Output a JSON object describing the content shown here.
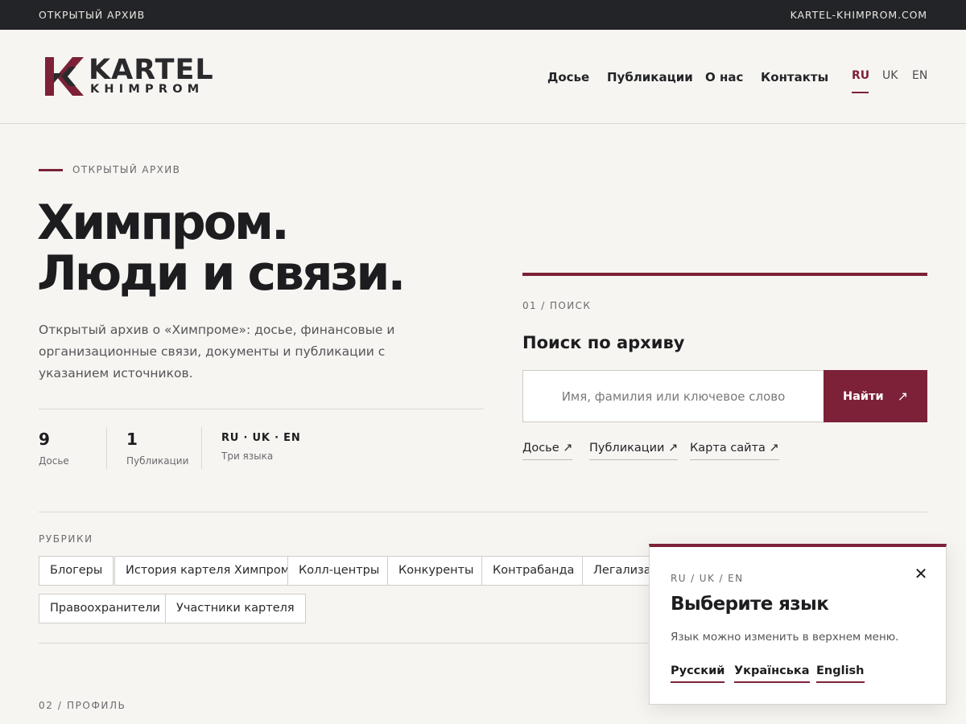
{
  "topbar": {
    "left_text": "ОТКРЫТЫЙ АРХИВ",
    "right_text": "KARTEL-KHIMPROM.COM"
  },
  "logo": {
    "word": "KARTEL",
    "sub": "KHIMPROM"
  },
  "nav": {
    "items": [
      "Досье",
      "Публикации",
      "О нас",
      "Контакты"
    ],
    "languages": [
      "RU",
      "UK",
      "EN"
    ],
    "active_language": "RU"
  },
  "hero": {
    "eyebrow": "ОТКРЫТЫЙ АРХИВ",
    "title_line1": "Химпром.",
    "title_line2": "Люди и связи.",
    "description": "Открытый архив о «Химпроме»: досье, финансовые и организационные связи, документы и публикации с указанием источников."
  },
  "stats": [
    {
      "value": "9",
      "label": "Досье"
    },
    {
      "value": "1",
      "label": "Публикации"
    },
    {
      "value": "RU · UK · EN",
      "label": "Три языка"
    }
  ],
  "search": {
    "eyebrow": "01 / ПОИСК",
    "title": "Поиск по архиву",
    "placeholder": "Имя, фамилия или ключевое слово",
    "button_label": "Найти",
    "button_icon": "arrow-up-right-icon",
    "quick_links": [
      "Досье ↗",
      "Публикации ↗",
      "Карта сайта ↗"
    ]
  },
  "rubrics": {
    "title": "РУБРИКИ",
    "items": [
      "Блогеры",
      "История картеля Химпром",
      "Колл-центры",
      "Конкуренты",
      "Контрабанда",
      "Легализация",
      "Правоохранители",
      "Участники картеля"
    ]
  },
  "profile": {
    "eyebrow": "02 / ПРОФИЛЬ"
  },
  "language_popup": {
    "eyebrow": "RU / UK / EN",
    "title": "Выберите язык",
    "text": "Язык можно изменить в верхнем меню.",
    "options": [
      "Русский",
      "Українська",
      "English"
    ],
    "close_icon": "close-icon"
  },
  "colors": {
    "accent": "#7c2137",
    "topbar_bg": "#232427",
    "page_bg": "#f7f5f2"
  }
}
